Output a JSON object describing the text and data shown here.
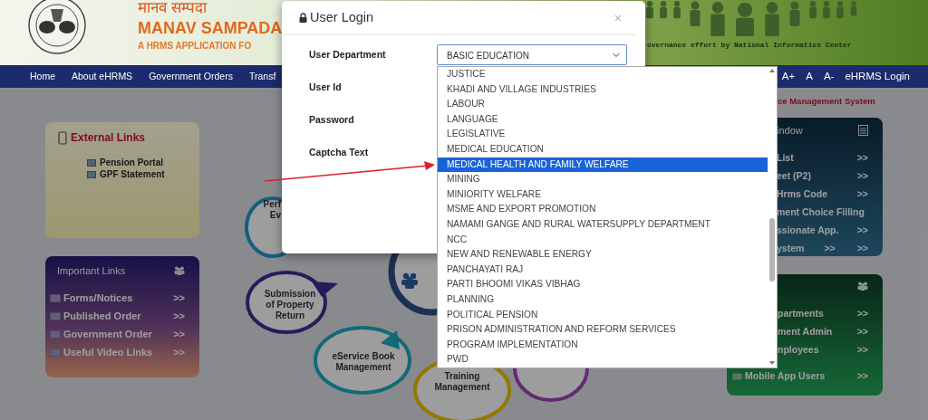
{
  "header": {
    "hindi_title": "मानव सम्पदा",
    "title": "MANAV SAMPADA",
    "subtitle": "A HRMS APPLICATION FO",
    "tagline": "overnance effort by National Informatics Center"
  },
  "navbar": {
    "items": [
      "Home",
      "About eHRMS",
      "Government Orders",
      "Transf"
    ],
    "font_controls": [
      "A+",
      "A",
      "A-"
    ],
    "login": "eHRMS Login"
  },
  "marquee": "ce Management System",
  "external_links": {
    "title": "External Links",
    "items": [
      "Pension Portal",
      "GPF Statement"
    ]
  },
  "important_links": {
    "title": "Important Links",
    "items": [
      {
        "label": "Forms/Notices",
        "arrow": ">>"
      },
      {
        "label": "Published Order",
        "arrow": ">>"
      },
      {
        "label": "Government Order",
        "arrow": ">>"
      },
      {
        "label": "Useful Video Links",
        "arrow": ">>"
      }
    ]
  },
  "service_circles": [
    {
      "lines": [
        "Perf",
        "Ev"
      ],
      "color": "#145d81"
    },
    {
      "lines": [
        "Submission",
        "of Property",
        "Return"
      ],
      "color": "#261b5b"
    },
    {
      "lines": [
        "eService Book",
        "Management"
      ],
      "color": "#126a78"
    },
    {
      "lines": [
        "Training",
        "Management"
      ],
      "color": "#937800"
    },
    {
      "color": "#652972"
    },
    {
      "color": "#1c3151"
    }
  ],
  "window_panel": {
    "title": "indow",
    "items": [
      {
        "label": "List",
        "arrows": [
          ">>"
        ]
      },
      {
        "label": "eet (P2)",
        "arrows": [
          ">>"
        ]
      },
      {
        "label": "Hrms Code",
        "arrows": [
          ">>"
        ]
      },
      {
        "label": "ment Choice Filling"
      },
      {
        "label": "ssionate App.",
        "arrows": [
          ">>"
        ]
      },
      {
        "label": "ystem",
        "arrows": [
          ">>",
          ">>"
        ]
      }
    ]
  },
  "green_panel": {
    "items": [
      {
        "label": "partments",
        "arrow": ">>"
      },
      {
        "label": "ment Admin",
        "arrow": ">>"
      },
      {
        "label": "nployees",
        "arrow": ">>"
      },
      {
        "label": "Mobile App Users",
        "arrow": ">>"
      }
    ]
  },
  "modal": {
    "title": "User Login",
    "close": "×",
    "fields": [
      {
        "label": "User Department"
      },
      {
        "label": "User Id"
      },
      {
        "label": "Password"
      },
      {
        "label": "Captcha Text"
      }
    ],
    "department_select": {
      "value": "BASIC EDUCATION"
    }
  },
  "dropdown": {
    "options": [
      {
        "label": "JUSTICE",
        "selected": false
      },
      {
        "label": "KHADI AND VILLAGE INDUSTRIES",
        "selected": false
      },
      {
        "label": "LABOUR",
        "selected": false
      },
      {
        "label": "LANGUAGE",
        "selected": false
      },
      {
        "label": "LEGISLATIVE",
        "selected": false
      },
      {
        "label": "MEDICAL EDUCATION",
        "selected": false
      },
      {
        "label": "MEDICAL HEALTH AND FAMILY WELFARE",
        "selected": true
      },
      {
        "label": "MINING",
        "selected": false
      },
      {
        "label": "MINIORITY WELFARE",
        "selected": false
      },
      {
        "label": "MSME AND EXPORT PROMOTION",
        "selected": false
      },
      {
        "label": "NAMAMI GANGE AND RURAL WATERSUPPLY DEPARTMENT",
        "selected": false
      },
      {
        "label": "NCC",
        "selected": false
      },
      {
        "label": "NEW AND RENEWABLE ENERGY",
        "selected": false
      },
      {
        "label": "PANCHAYATI RAJ",
        "selected": false
      },
      {
        "label": "PARTI BHOOMI VIKAS VIBHAG",
        "selected": false
      },
      {
        "label": "PLANNING",
        "selected": false
      },
      {
        "label": "POLITICAL PENSION",
        "selected": false
      },
      {
        "label": "PRISON ADMINISTRATION AND REFORM SERVICES",
        "selected": false
      },
      {
        "label": "PROGRAM IMPLEMENTATION",
        "selected": false
      },
      {
        "label": "PWD",
        "selected": false
      }
    ]
  }
}
